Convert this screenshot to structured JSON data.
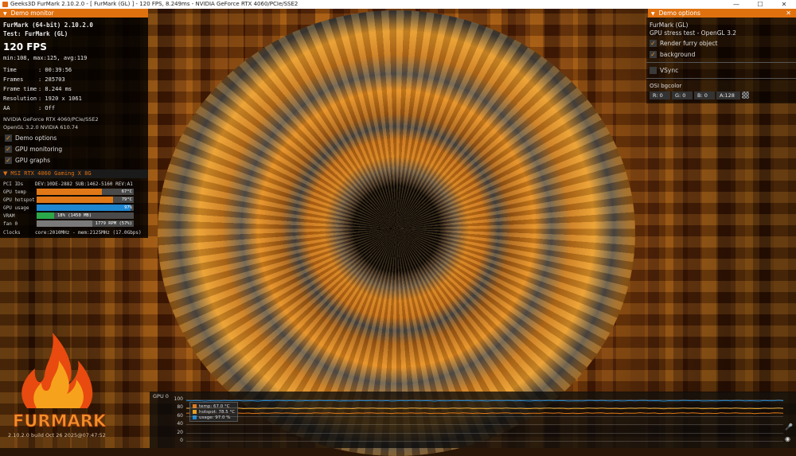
{
  "window": {
    "title": "Geeks3D FurMark 2.10.2.0 - [ FurMark (GL) ] - 120 FPS, 8.249ms - NVIDIA GeForce RTX 4060/PCIe/SSE2",
    "minimize": "—",
    "maximize": "☐",
    "close": "✕"
  },
  "demo_monitor": {
    "header": "Demo monitor",
    "app_name": "FurMark (64-bit) 2.10.2.0",
    "test": "Test: FurMark (GL)",
    "fps": "120 FPS",
    "fps_stats": "min:108, max:125, avg:119",
    "stats": [
      {
        "label": "Time",
        "value": ": 00:39:56"
      },
      {
        "label": "Frames",
        "value": ": 285703"
      },
      {
        "label": "Frame time",
        "value": ": 8.244 ms"
      },
      {
        "label": "Resolution",
        "value": ": 1920 x 1061"
      },
      {
        "label": "AA",
        "value": ": Off"
      }
    ],
    "renderer": "NVIDIA GeForce RTX 4060/PCIe/SSE2",
    "opengl": "OpenGL 3.2.0 NVIDIA 610.74",
    "options": [
      {
        "label": "Demo options",
        "checked": true
      },
      {
        "label": "GPU monitoring",
        "checked": true
      },
      {
        "label": "GPU graphs",
        "checked": true
      }
    ]
  },
  "gpu_card": {
    "header": "MSI RTX 4060 Gaming X 8G",
    "pci_label": "PCI IDs",
    "pci_value": "DEV:10DE-2882 SUB:1462-5160 REV:A1",
    "metrics": [
      {
        "label": "GPU temp",
        "text": "67°C",
        "fraction": 0.67,
        "color": "#e07818"
      },
      {
        "label": "GPU hotspot",
        "text": "79°C",
        "fraction": 0.79,
        "color": "#e07818"
      },
      {
        "label": "GPU usage",
        "text": "97%",
        "fraction": 0.97,
        "color": "#1f86d0"
      },
      {
        "label": "VRAM",
        "text": "18% (1450 MB)",
        "fraction": 0.18,
        "color": "#2aa84a"
      },
      {
        "label": "fan 0",
        "text": "1779 RPM (57%)",
        "fraction": 0.57,
        "color": "#7a7a7a"
      }
    ],
    "clocks_label": "Clocks",
    "clocks_value": "core:2010MHz - mem:2125MHz (17.0Gbps)"
  },
  "demo_options": {
    "header": "Demo options",
    "name": "FurMark (GL)",
    "subtitle": "GPU stress test - OpenGL 3.2",
    "render_furry": {
      "label": "Render furry object",
      "checked": true
    },
    "background": {
      "label": "background",
      "checked": true
    },
    "vsync": {
      "label": "VSync",
      "checked": false
    },
    "osi_label": "OSI bgcolor",
    "color_fields": [
      "R: 0",
      "G: 0",
      "B: 0",
      "A:128"
    ]
  },
  "graph": {
    "title": "GPU 0",
    "y_ticks": [
      "100",
      "80",
      "60",
      "40",
      "20",
      "0"
    ],
    "legend": [
      {
        "label": "temp: 67.0 °C",
        "color": "#e07818"
      },
      {
        "label": "hotspot: 78.5 °C",
        "color": "#e8a020"
      },
      {
        "label": "usage: 97.0 %",
        "color": "#1f86d0"
      }
    ],
    "series_levels": {
      "temp": 67,
      "hotspot": 78.5,
      "usage": 97
    }
  },
  "branding": {
    "logo": "FURMARK",
    "build": "2.10.2.0 build Oct 26 2025@07:47:52"
  }
}
